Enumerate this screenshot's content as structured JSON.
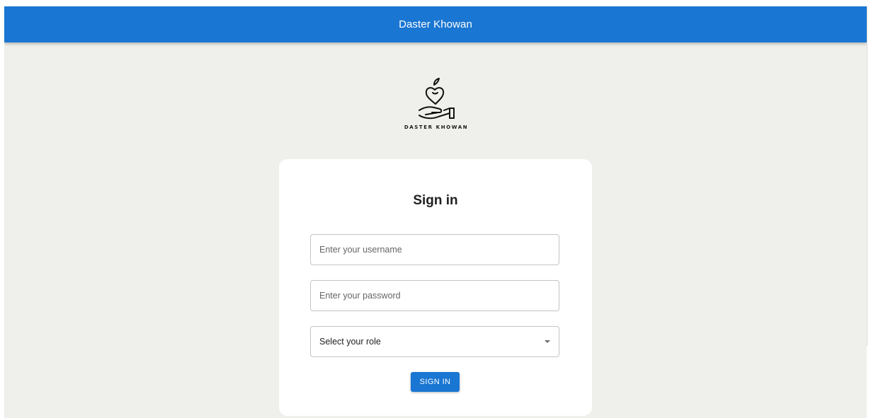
{
  "appbar": {
    "title": "Daster Khowan"
  },
  "logo": {
    "text": "DASTER KHOWAN",
    "icon": "heart-in-hand-icon"
  },
  "signin": {
    "title": "Sign in",
    "username_placeholder": "Enter your username",
    "password_placeholder": "Enter your password",
    "role_select_value": "Select your role",
    "submit_label": "SIGN IN"
  },
  "colors": {
    "primary": "#1976d2",
    "background": "#efefeb",
    "card": "#ffffff"
  }
}
